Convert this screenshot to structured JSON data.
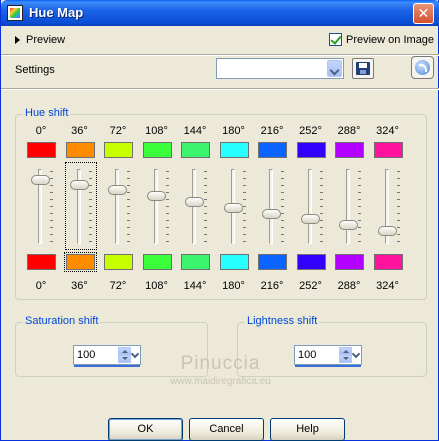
{
  "window": {
    "title": "Hue Map",
    "close_symbol": "✕"
  },
  "preview": {
    "label": "Preview",
    "preview_on_image_label": "Preview on Image",
    "preview_on_image_checked": true
  },
  "settings": {
    "label": "Settings",
    "preset_value": ""
  },
  "hue_shift": {
    "label": "Hue shift",
    "channels": [
      {
        "degree": "0°",
        "color": "#ff0000",
        "slider": 0.88
      },
      {
        "degree": "36°",
        "color": "#ff8c00",
        "slider": 0.8
      },
      {
        "degree": "72°",
        "color": "#c8ff00",
        "slider": 0.73
      },
      {
        "degree": "108°",
        "color": "#3cff3c",
        "slider": 0.64
      },
      {
        "degree": "144°",
        "color": "#3cf36e",
        "slider": 0.55
      },
      {
        "degree": "180°",
        "color": "#28ffff",
        "slider": 0.46
      },
      {
        "degree": "216°",
        "color": "#0a64ff",
        "slider": 0.37
      },
      {
        "degree": "252°",
        "color": "#3200ff",
        "slider": 0.29
      },
      {
        "degree": "288°",
        "color": "#b400ff",
        "slider": 0.2
      },
      {
        "degree": "324°",
        "color": "#ff14a0",
        "slider": 0.11
      }
    ],
    "bottom_colors": [
      "#ff0000",
      "#ff8c00",
      "#c8ff00",
      "#3cff3c",
      "#3cf36e",
      "#28ffff",
      "#0a64ff",
      "#3200ff",
      "#b400ff",
      "#ff14a0"
    ]
  },
  "saturation": {
    "label": "Saturation shift",
    "value": "100"
  },
  "lightness": {
    "label": "Lightness shift",
    "value": "100"
  },
  "watermark": {
    "line1": "Pinuccia",
    "line2": "www.maidiregrafica.eu"
  },
  "buttons": {
    "ok": "OK",
    "cancel": "Cancel",
    "help": "Help"
  }
}
